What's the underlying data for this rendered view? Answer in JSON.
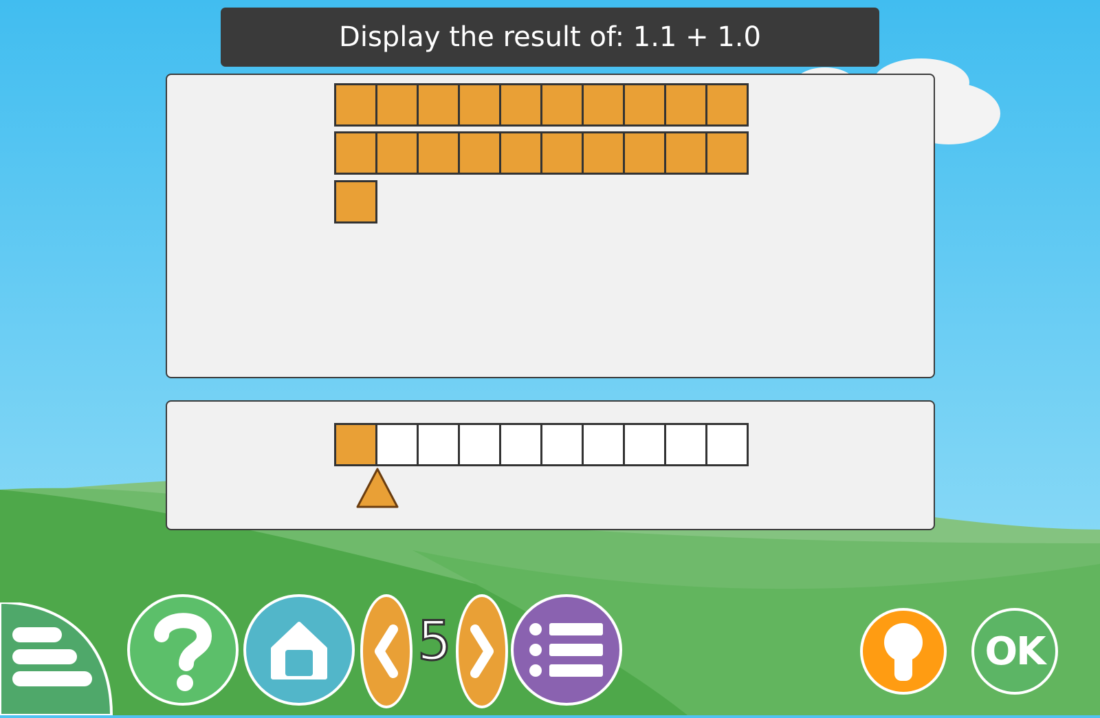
{
  "prompt": {
    "text": "Display the result of: 1.1 + 1.0"
  },
  "workspace": {
    "rows": [
      {
        "filled": 10
      },
      {
        "filled": 10
      },
      {
        "filled": 1
      }
    ],
    "colors": {
      "block": "#e9a036",
      "panel": "#f1f1f1"
    }
  },
  "tenths_bar": {
    "cells": 10,
    "filled": 1,
    "pointer_position": 1
  },
  "toolbar": {
    "menu_icon": "menu-icon",
    "help_icon": "question-icon",
    "home_icon": "home-icon",
    "prev_icon": "chevron-left-icon",
    "page_number": "5",
    "next_icon": "chevron-right-icon",
    "list_icon": "list-icon",
    "hint_icon": "keyhole-icon",
    "ok_label": "OK",
    "colors": {
      "help": "#5cbf6a",
      "home": "#52b6c9",
      "nav": "#e9a036",
      "list": "#8a62b0",
      "hint": "#ff9c12",
      "ok": "#5cb565",
      "menu": "#4fa86a"
    }
  }
}
